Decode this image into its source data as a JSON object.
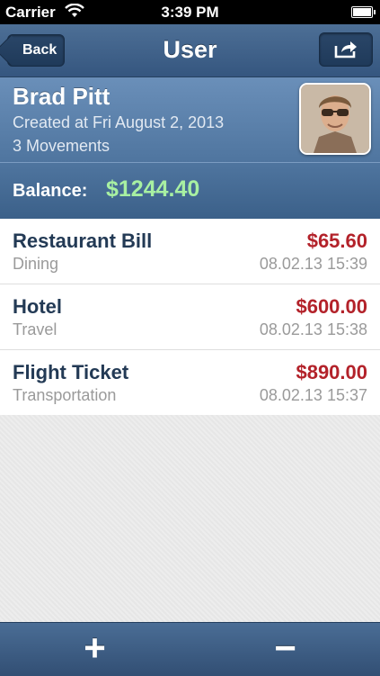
{
  "status_bar": {
    "carrier": "Carrier",
    "time": "3:39 PM"
  },
  "nav": {
    "back_label": "Back",
    "title": "User",
    "share_icon": "share-icon"
  },
  "profile": {
    "name": "Brad Pitt",
    "created": "Created at Fri August 2, 2013",
    "movements": "3 Movements",
    "balance_label": "Balance:",
    "balance_value": "$1244.40"
  },
  "movements": [
    {
      "title": "Restaurant Bill",
      "category": "Dining",
      "amount": "$65.60",
      "date": "08.02.13 15:39"
    },
    {
      "title": "Hotel",
      "category": "Travel",
      "amount": "$600.00",
      "date": "08.02.13 15:38"
    },
    {
      "title": "Flight Ticket",
      "category": "Transportation",
      "amount": "$890.00",
      "date": "08.02.13 15:37"
    }
  ],
  "toolbar": {
    "add_glyph": "+",
    "remove_glyph": "−"
  },
  "colors": {
    "nav": "#3f6189",
    "amount_red": "#b3222a",
    "balance_green": "#a8f0a2"
  }
}
